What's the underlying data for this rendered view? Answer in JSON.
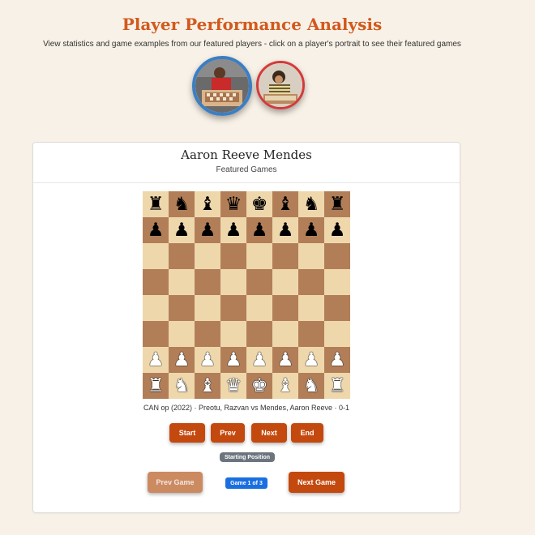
{
  "header": {
    "title": "Player Performance Analysis",
    "subtitle": "View statistics and game examples from our featured players - click on a player's portrait to see their featured games"
  },
  "portraits": [
    {
      "icon": "player-portrait-photo",
      "selected": true,
      "ring_color": "#3a7fc4"
    },
    {
      "icon": "player-portrait-photo",
      "selected": false,
      "ring_color": "#d43a3a"
    }
  ],
  "card": {
    "player_name": "Aaron Reeve Mendes",
    "section_label": "Featured Games",
    "game_info": "CAN op (2022) · Preotu, Razvan vs Mendes, Aaron Reeve · 0-1",
    "buttons": {
      "start": "Start",
      "prev": "Prev",
      "next": "Next",
      "end": "End",
      "prev_game": "Prev Game",
      "next_game": "Next Game"
    },
    "status": "Starting Position",
    "game_counter": "Game 1 of 3"
  },
  "board": {
    "light_color": "#efd7ac",
    "dark_color": "#b27e58",
    "ranks": [
      "rnbqkbnr",
      "pppppppp",
      "........",
      "........",
      "........",
      "........",
      "PPPPPPPP",
      "RNBQKBNR"
    ]
  },
  "colors": {
    "accent": "#d2591d",
    "button": "#c4490f",
    "badge_blue": "#1a6fe0",
    "badge_gray": "#6c757d"
  }
}
